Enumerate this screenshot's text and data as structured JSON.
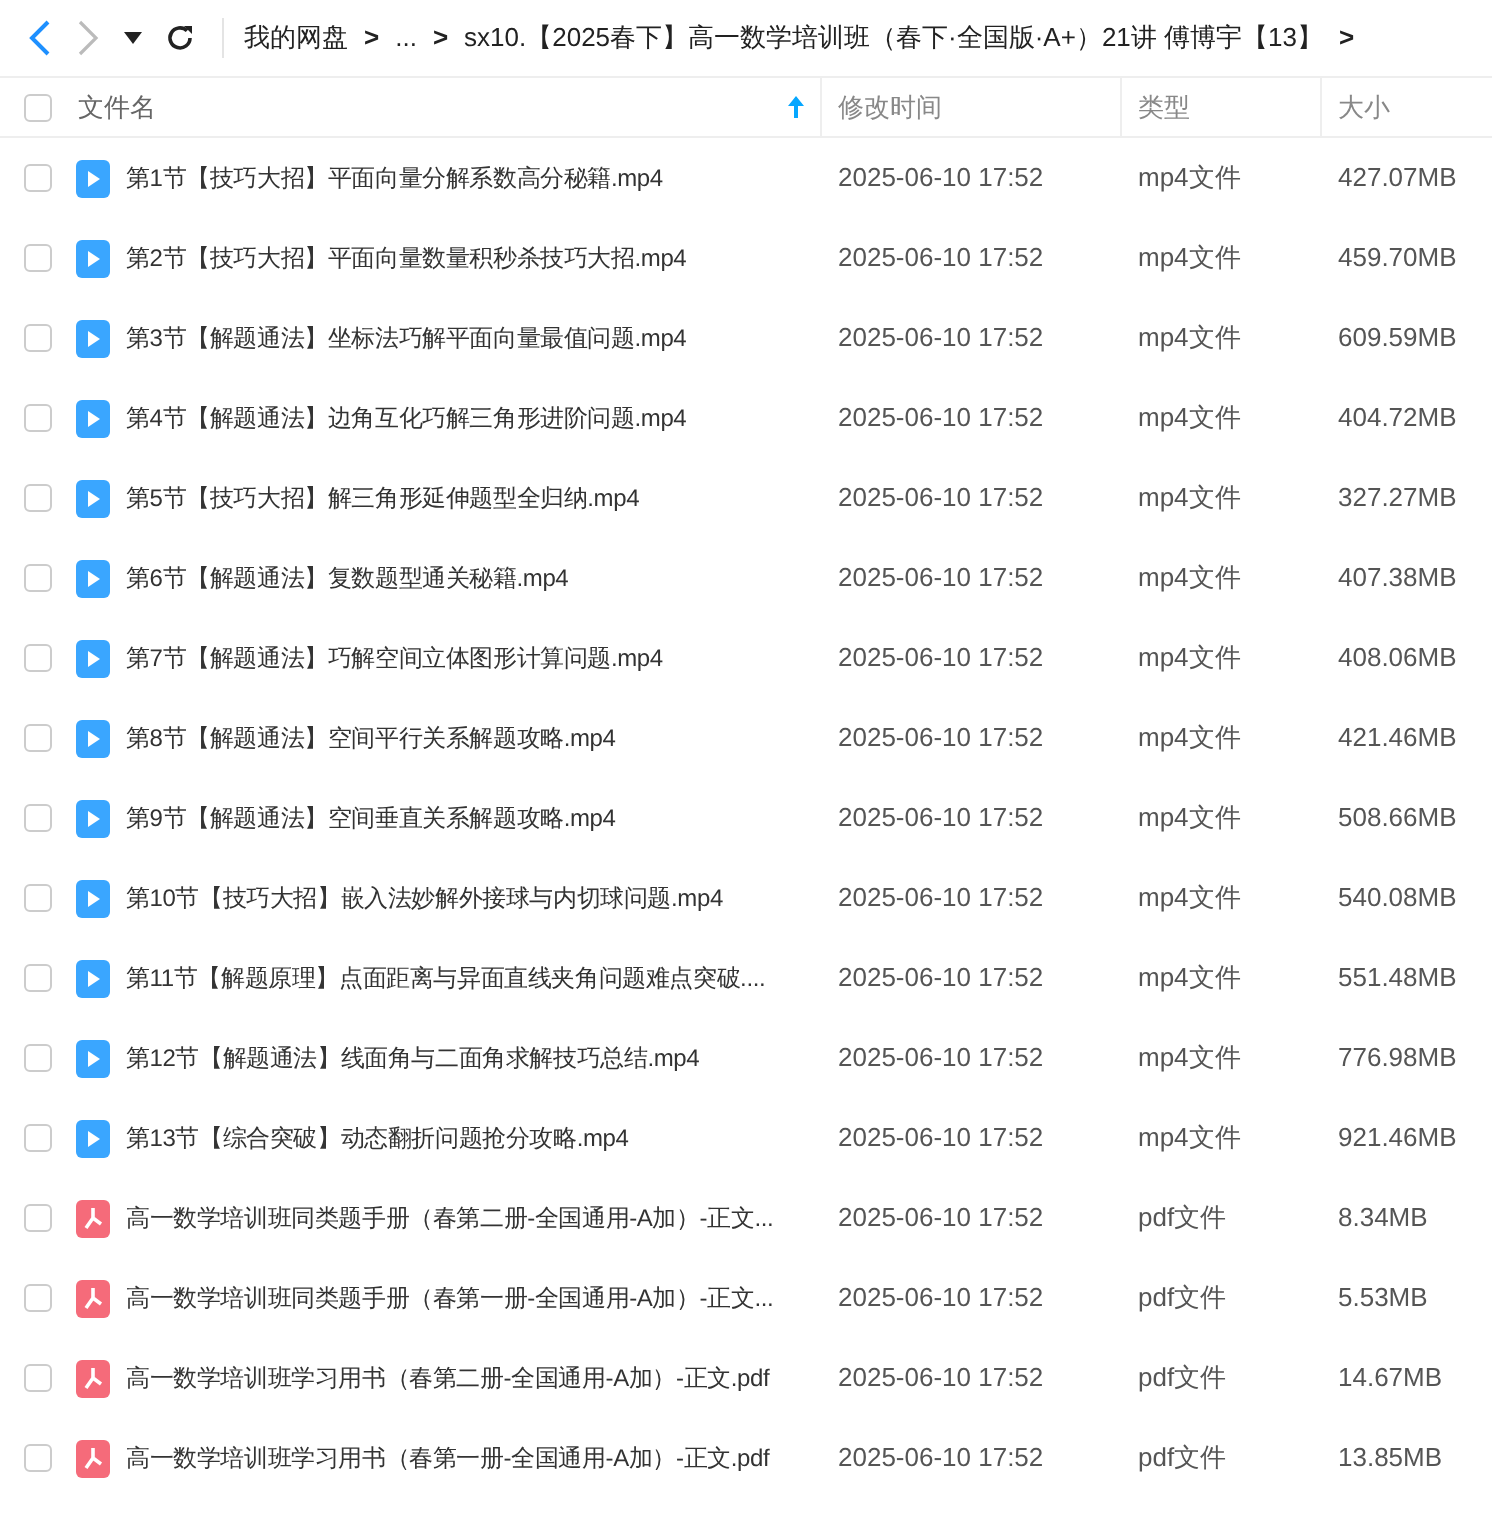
{
  "breadcrumb": {
    "items": [
      "我的网盘",
      "...",
      "sx10.【2025春下】高一数学培训班（春下·全国版·A+）21讲 傅博宇【13】"
    ],
    "separators": [
      ">",
      ">"
    ],
    "trailing": ">"
  },
  "table": {
    "columns": [
      {
        "label": "文件名",
        "sorted": true
      },
      {
        "label": "修改时间",
        "sorted": false
      },
      {
        "label": "类型",
        "sorted": false
      },
      {
        "label": "大小",
        "sorted": false
      }
    ],
    "all_checked": false,
    "rows": [
      {
        "kind": "video",
        "checked": false,
        "name": "第1节【技巧大招】平面向量分解系数高分秘籍.mp4",
        "modified": "2025-06-10 17:52",
        "type": "mp4文件",
        "size": "427.07MB"
      },
      {
        "kind": "video",
        "checked": false,
        "name": "第2节【技巧大招】平面向量数量积秒杀技巧大招.mp4",
        "modified": "2025-06-10 17:52",
        "type": "mp4文件",
        "size": "459.70MB"
      },
      {
        "kind": "video",
        "checked": false,
        "name": "第3节【解题通法】坐标法巧解平面向量最值问题.mp4",
        "modified": "2025-06-10 17:52",
        "type": "mp4文件",
        "size": "609.59MB"
      },
      {
        "kind": "video",
        "checked": false,
        "name": "第4节【解题通法】边角互化巧解三角形进阶问题.mp4",
        "modified": "2025-06-10 17:52",
        "type": "mp4文件",
        "size": "404.72MB"
      },
      {
        "kind": "video",
        "checked": false,
        "name": "第5节【技巧大招】解三角形延伸题型全归纳.mp4",
        "modified": "2025-06-10 17:52",
        "type": "mp4文件",
        "size": "327.27MB"
      },
      {
        "kind": "video",
        "checked": false,
        "name": "第6节【解题通法】复数题型通关秘籍.mp4",
        "modified": "2025-06-10 17:52",
        "type": "mp4文件",
        "size": "407.38MB"
      },
      {
        "kind": "video",
        "checked": false,
        "name": "第7节【解题通法】巧解空间立体图形计算问题.mp4",
        "modified": "2025-06-10 17:52",
        "type": "mp4文件",
        "size": "408.06MB"
      },
      {
        "kind": "video",
        "checked": false,
        "name": "第8节【解题通法】空间平行关系解题攻略.mp4",
        "modified": "2025-06-10 17:52",
        "type": "mp4文件",
        "size": "421.46MB"
      },
      {
        "kind": "video",
        "checked": false,
        "name": "第9节【解题通法】空间垂直关系解题攻略.mp4",
        "modified": "2025-06-10 17:52",
        "type": "mp4文件",
        "size": "508.66MB"
      },
      {
        "kind": "video",
        "checked": false,
        "name": "第10节【技巧大招】嵌入法妙解外接球与内切球问题.mp4",
        "modified": "2025-06-10 17:52",
        "type": "mp4文件",
        "size": "540.08MB"
      },
      {
        "kind": "video",
        "checked": false,
        "name": "第11节【解题原理】点面距离与异面直线夹角问题难点突破....",
        "modified": "2025-06-10 17:52",
        "type": "mp4文件",
        "size": "551.48MB"
      },
      {
        "kind": "video",
        "checked": false,
        "name": "第12节【解题通法】线面角与二面角求解技巧总结.mp4",
        "modified": "2025-06-10 17:52",
        "type": "mp4文件",
        "size": "776.98MB"
      },
      {
        "kind": "video",
        "checked": false,
        "name": "第13节【综合突破】动态翻折问题抢分攻略.mp4",
        "modified": "2025-06-10 17:52",
        "type": "mp4文件",
        "size": "921.46MB"
      },
      {
        "kind": "pdf",
        "checked": false,
        "name": "高一数学培训班同类题手册（春第二册-全国通用-A加）-正文...",
        "modified": "2025-06-10 17:52",
        "type": "pdf文件",
        "size": "8.34MB"
      },
      {
        "kind": "pdf",
        "checked": false,
        "name": "高一数学培训班同类题手册（春第一册-全国通用-A加）-正文...",
        "modified": "2025-06-10 17:52",
        "type": "pdf文件",
        "size": "5.53MB"
      },
      {
        "kind": "pdf",
        "checked": false,
        "name": "高一数学培训班学习用书（春第二册-全国通用-A加）-正文.pdf",
        "modified": "2025-06-10 17:52",
        "type": "pdf文件",
        "size": "14.67MB"
      },
      {
        "kind": "pdf",
        "checked": false,
        "name": "高一数学培训班学习用书（春第一册-全国通用-A加）-正文.pdf",
        "modified": "2025-06-10 17:52",
        "type": "pdf文件",
        "size": "13.85MB"
      }
    ]
  }
}
